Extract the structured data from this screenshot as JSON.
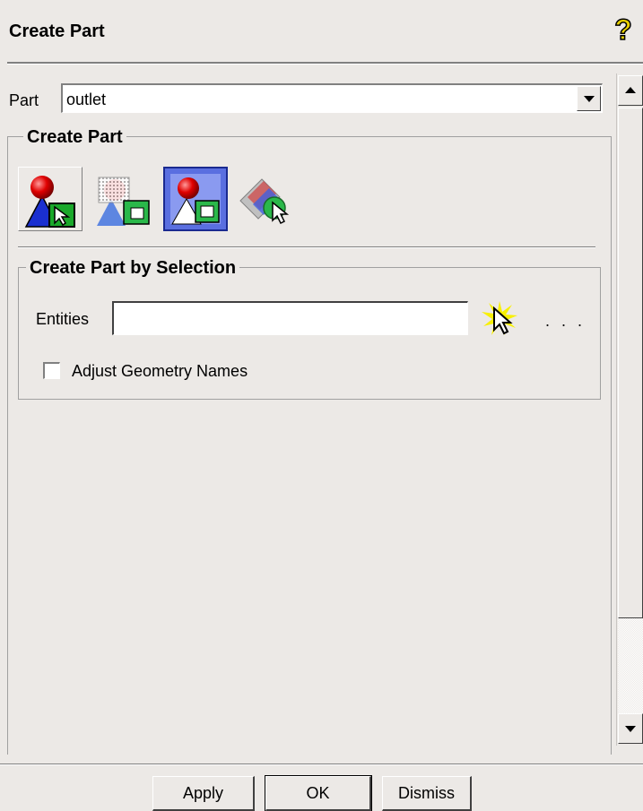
{
  "window": {
    "title": "Create Part",
    "help_icon": "help-question-icon"
  },
  "part": {
    "label": "Part",
    "value": "outlet"
  },
  "create_part_group": {
    "legend": "Create Part",
    "tools": [
      {
        "name": "create-part-by-selection",
        "icon": "sphere-triangle-select-icon",
        "active": true
      },
      {
        "name": "create-part-by-region",
        "icon": "region-select-icon",
        "active": false
      },
      {
        "name": "create-part-by-element",
        "icon": "element-select-icon",
        "active": false
      },
      {
        "name": "create-part-by-entity",
        "icon": "entity-select-icon",
        "active": false
      }
    ]
  },
  "selection_group": {
    "legend": "Create Part by Selection",
    "entities_label": "Entities",
    "entities_value": "",
    "select_icon": "select-cursor-icon",
    "more_label": ". . .",
    "adjust_names_label": "Adjust Geometry Names",
    "adjust_names_checked": false
  },
  "buttons": {
    "apply": "Apply",
    "ok": "OK",
    "dismiss": "Dismiss"
  }
}
